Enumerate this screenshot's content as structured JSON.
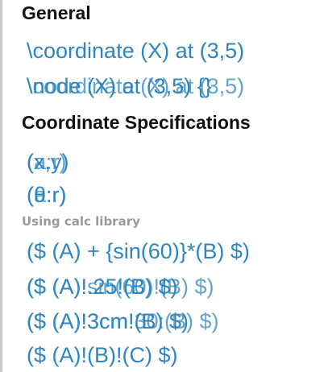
{
  "sections": [
    {
      "heading": "General",
      "snippets": [
        {
          "text": "\\coordinate (X) at (3,5)"
        },
        {
          "text": "\\node (X) at (3,5) {}",
          "overlay": "\\coordinate (X) at (3,5)"
        }
      ]
    },
    {
      "heading": "Coordinate Specifications",
      "snippets": [
        {
          "text": "(x,y)",
          "overlay": "(a:r)"
        },
        {
          "text": "(θ:r)",
          "overlay": "(a:r)"
        }
      ]
    },
    {
      "subheading": "Using calc library",
      "snippets": [
        {
          "text": "($ (A) + {sin(60)}*(B) $)"
        },
        {
          "text": "($ (A)!.25!(B) $)",
          "overlay": "($ (A)!sin(60)!(B) $)"
        },
        {
          "text": "($ (A)!3cm!(B) $)",
          "overlay": "($ (A)!3cm!30:(B) $)"
        },
        {
          "text": "($ (A)!(B)!(C) $)"
        }
      ]
    }
  ],
  "colors": {
    "snippet": "#2e86c1",
    "heading": "#111111",
    "subheading": "#9a9a9a",
    "rule": "#c7c9cc"
  }
}
